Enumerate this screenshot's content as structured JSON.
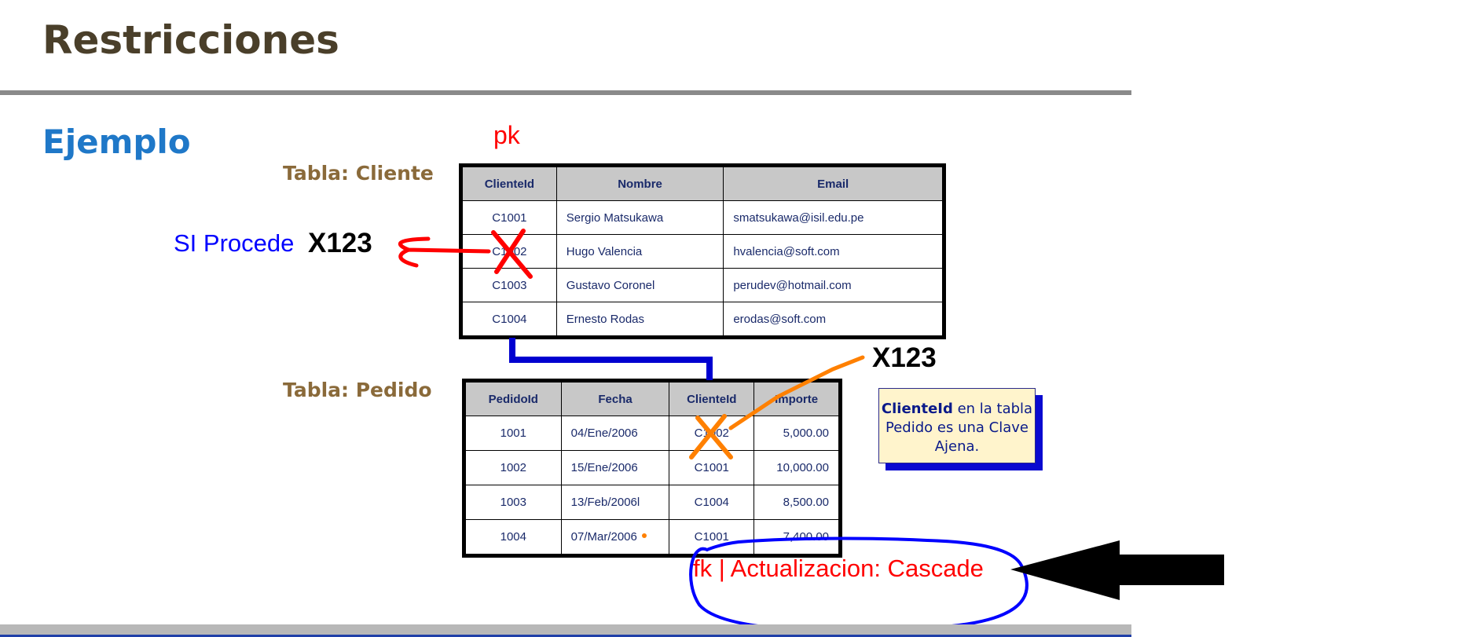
{
  "title": "Restricciones",
  "subtitle": "Ejemplo",
  "cliente_label": "Tabla: Cliente",
  "pedido_label": "Tabla: Pedido",
  "pk_label": "pk",
  "si_procede": "SI Procede",
  "x123_left": "X123",
  "x123_right": "X123",
  "note": {
    "bold": "ClienteId",
    "rest": " en la tabla Pedido es una Clave Ajena."
  },
  "cascade": "fk | Actualizacion: Cascade",
  "cliente": {
    "headers": [
      "ClienteId",
      "Nombre",
      "Email"
    ],
    "rows": [
      [
        "C1001",
        "Sergio Matsukawa",
        "smatsukawa@isil.edu.pe"
      ],
      [
        "C1002",
        "Hugo Valencia",
        "hvalencia@soft.com"
      ],
      [
        "C1003",
        "Gustavo Coronel",
        "perudev@hotmail.com"
      ],
      [
        "C1004",
        "Ernesto Rodas",
        "erodas@soft.com"
      ]
    ]
  },
  "pedido": {
    "headers": [
      "PedidoId",
      "Fecha",
      "ClienteId",
      "Importe"
    ],
    "rows": [
      [
        "1001",
        "04/Ene/2006",
        "C1002",
        "5,000.00"
      ],
      [
        "1002",
        "15/Ene/2006",
        "C1001",
        "10,000.00"
      ],
      [
        "1003",
        "13/Feb/2006l",
        "C1004",
        "8,500.00"
      ],
      [
        "1004",
        "07/Mar/2006",
        "C1001",
        "7,400.00"
      ]
    ]
  },
  "colors": {
    "title": "#4a3f2a",
    "subtitle": "#1f78c8",
    "annotation_red": "#ff0000",
    "annotation_blue": "#0000ff",
    "annotation_orange": "#ff8000"
  }
}
